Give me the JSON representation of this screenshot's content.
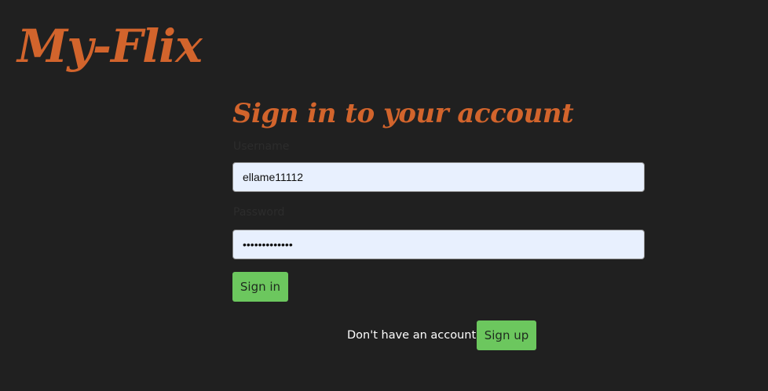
{
  "app": {
    "logo_text": "My-Flix"
  },
  "login_form": {
    "title": "Sign in to your account",
    "username_label": "Username",
    "username_value": "ellame11112",
    "password_label": "Password",
    "password_value": "•••••••••••••",
    "signin_label": "Sign in"
  },
  "signup": {
    "prompt": "Don't have an account?",
    "button_label": "Sign up"
  },
  "colors": {
    "background": "#202020",
    "brand": "#d2642c",
    "button": "#6cc75e",
    "input_background": "#e8f0fe"
  }
}
